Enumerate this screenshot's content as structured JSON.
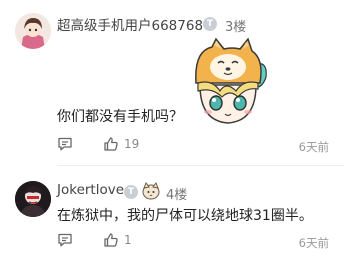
{
  "comments": [
    {
      "username": "超高级手机用户668768",
      "badge": "T",
      "floor": "3楼",
      "text": "你们都没有手机吗？",
      "sticker": "shiba-dog-hat-girl-sticker",
      "likes": "19",
      "time": "6天前"
    },
    {
      "username": "Jokertlove",
      "badge": "T",
      "floor": "4楼",
      "text": "在炼狱中，我的尸体可以绕地球31圈半。",
      "likes": "1",
      "time": "6天前"
    }
  ],
  "colors": {
    "text": "#222222",
    "meta": "#999999",
    "badge": "#c9ced6"
  }
}
